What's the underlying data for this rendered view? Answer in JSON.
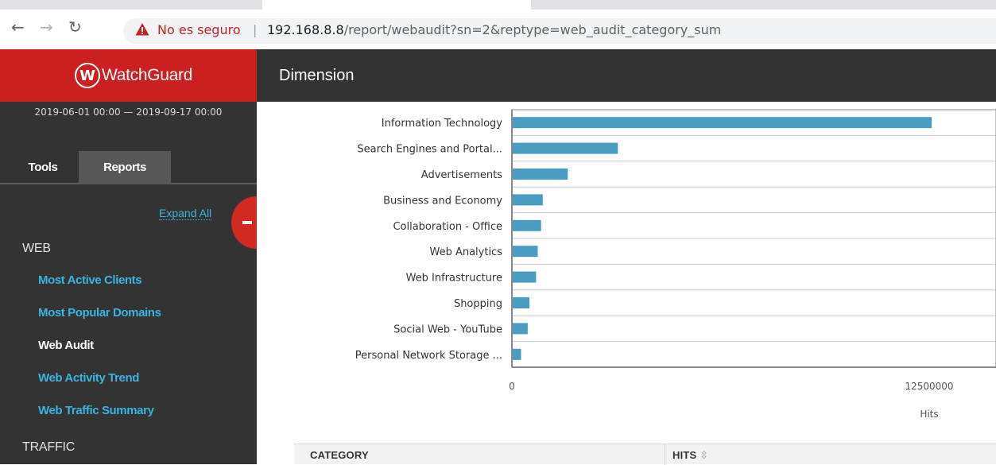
{
  "browser": {
    "security_label": "No es seguro",
    "separator": "|",
    "url_host": "192.168.8.8",
    "url_path": "/report/webaudit?sn=2&reptype=web_audit_category_sum"
  },
  "sidebar": {
    "brand": "WatchGuard",
    "brand_initial": "W",
    "date_range": "2019-06-01 00:00 — 2019-09-17 00:00",
    "tabs": [
      "Tools",
      "Reports"
    ],
    "expand_all": "Expand All",
    "section_web": "WEB",
    "items": [
      "Most Active Clients",
      "Most Popular Domains",
      "Web Audit",
      "Web Activity Trend",
      "Web Traffic Summary"
    ],
    "section_traffic": "TRAFFIC"
  },
  "main": {
    "title": "Dimension"
  },
  "chart_data": {
    "type": "bar",
    "orientation": "horizontal",
    "categories": [
      "Information Technology",
      "Search Engines and Portal...",
      "Advertisements",
      "Business and Economy",
      "Collaboration - Office",
      "Web Analytics",
      "Web Infrastructure",
      "Shopping",
      "Social Web - YouTube",
      "Personal Network Storage ..."
    ],
    "values": [
      12550000,
      3150000,
      1650000,
      900000,
      850000,
      750000,
      700000,
      500000,
      450000,
      250000
    ],
    "xlabel": "Hits",
    "xticks": [
      "0",
      "12500000"
    ],
    "xlim": [
      0,
      14500000
    ],
    "bar_color": "#4a9cc1"
  },
  "table": {
    "columns": [
      "CATEGORY",
      "HITS"
    ],
    "sort_icon": "⇳"
  }
}
